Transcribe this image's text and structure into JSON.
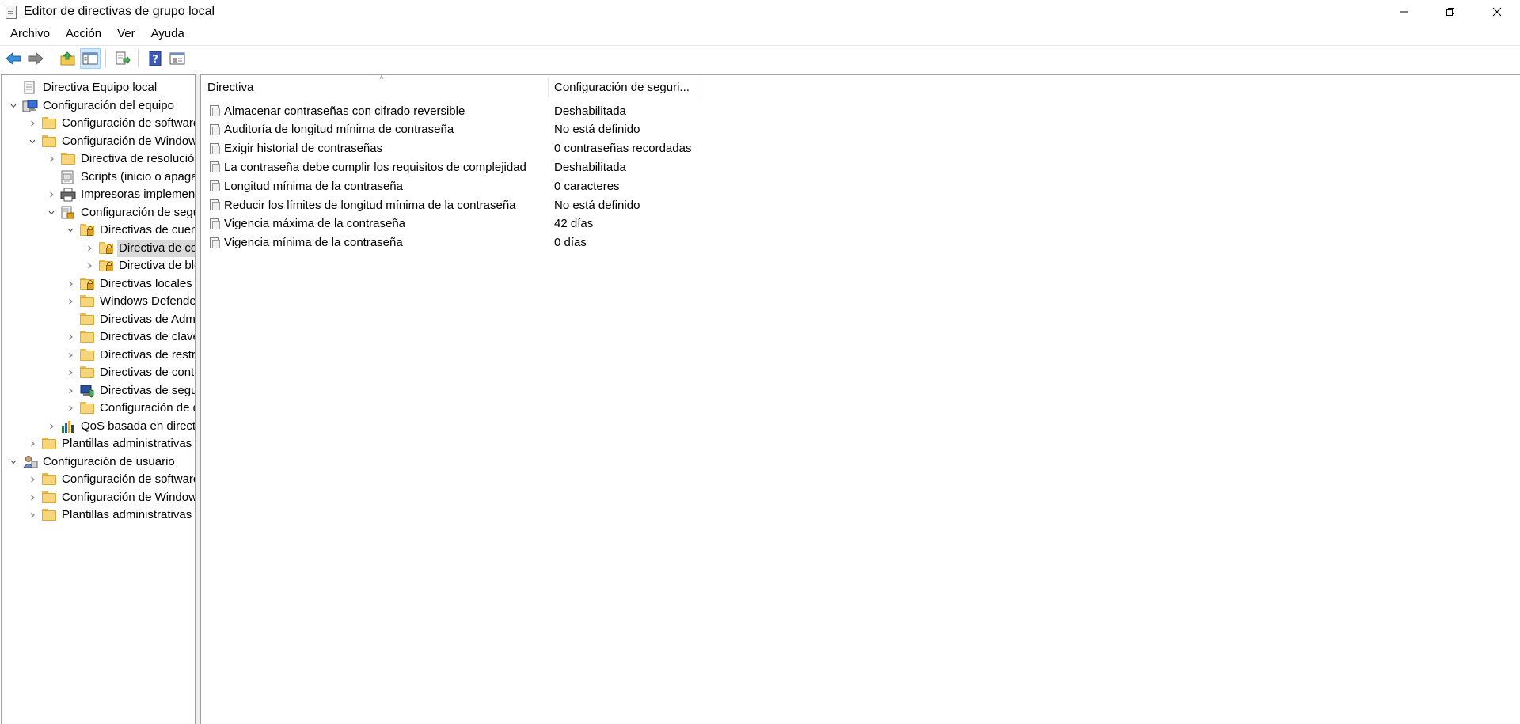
{
  "window": {
    "title": "Editor de directivas de grupo local"
  },
  "menu": [
    "Archivo",
    "Acción",
    "Ver",
    "Ayuda"
  ],
  "toolbar": {
    "icons": [
      "back-arrow-icon",
      "forward-arrow-icon",
      "up-folder-icon",
      "show-hide-tree-icon",
      "export-list-icon",
      "help-icon",
      "properties-icon"
    ]
  },
  "tree": [
    {
      "label": "Directiva Equipo local",
      "depth": 0,
      "icon": "policy-doc-icon",
      "expander": ""
    },
    {
      "label": "Configuración del equipo",
      "depth": 0,
      "icon": "computer-icon",
      "expander": "expanded"
    },
    {
      "label": "Configuración de software",
      "depth": 1,
      "icon": "folder-icon",
      "expander": "collapsed"
    },
    {
      "label": "Configuración de Windows",
      "depth": 1,
      "icon": "folder-icon",
      "expander": "expanded"
    },
    {
      "label": "Directiva de resolución de nombres",
      "depth": 2,
      "icon": "folder-icon",
      "expander": "collapsed"
    },
    {
      "label": "Scripts (inicio o apagado)",
      "depth": 2,
      "icon": "scripts-icon",
      "expander": ""
    },
    {
      "label": "Impresoras implementadas",
      "depth": 2,
      "icon": "printer-icon",
      "expander": "collapsed"
    },
    {
      "label": "Configuración de seguridad",
      "depth": 2,
      "icon": "security-settings-icon",
      "expander": "expanded"
    },
    {
      "label": "Directivas de cuenta",
      "depth": 3,
      "icon": "locked-folder-icon",
      "expander": "expanded"
    },
    {
      "label": "Directiva de contraseñas",
      "depth": 4,
      "icon": "locked-folder-icon",
      "expander": "collapsed",
      "selected": true
    },
    {
      "label": "Directiva de bloqueo de cuenta",
      "depth": 4,
      "icon": "locked-folder-icon",
      "expander": "collapsed"
    },
    {
      "label": "Directivas locales",
      "depth": 3,
      "icon": "locked-folder-icon",
      "expander": "collapsed"
    },
    {
      "label": "Windows Defender Firewall",
      "depth": 3,
      "icon": "folder-icon",
      "expander": "collapsed"
    },
    {
      "label": "Directivas de Administrador de listas de redes",
      "depth": 3,
      "icon": "folder-icon",
      "expander": ""
    },
    {
      "label": "Directivas de clave pública",
      "depth": 3,
      "icon": "folder-icon",
      "expander": "collapsed"
    },
    {
      "label": "Directivas de restricción de software",
      "depth": 3,
      "icon": "folder-icon",
      "expander": "collapsed"
    },
    {
      "label": "Directivas de control de aplicaciones",
      "depth": 3,
      "icon": "folder-icon",
      "expander": "collapsed"
    },
    {
      "label": "Directivas de seguridad IP",
      "depth": 3,
      "icon": "ip-security-icon",
      "expander": "collapsed"
    },
    {
      "label": "Configuración de directiva de auditoría avanzada",
      "depth": 3,
      "icon": "folder-icon",
      "expander": "collapsed"
    },
    {
      "label": "QoS basada en directivas",
      "depth": 2,
      "icon": "qos-chart-icon",
      "expander": "collapsed"
    },
    {
      "label": "Plantillas administrativas",
      "depth": 1,
      "icon": "folder-icon",
      "expander": "collapsed"
    },
    {
      "label": "Configuración de usuario",
      "depth": 0,
      "icon": "user-icon",
      "expander": "expanded"
    },
    {
      "label": "Configuración de software",
      "depth": 1,
      "icon": "folder-icon",
      "expander": "collapsed"
    },
    {
      "label": "Configuración de Windows",
      "depth": 1,
      "icon": "folder-icon",
      "expander": "collapsed"
    },
    {
      "label": "Plantillas administrativas",
      "depth": 1,
      "icon": "folder-icon",
      "expander": "collapsed"
    }
  ],
  "list": {
    "columns": [
      "Directiva",
      "Configuración de seguri..."
    ],
    "rows": [
      {
        "name": "Almacenar contraseñas con cifrado reversible",
        "value": "Deshabilitada"
      },
      {
        "name": "Auditoría de longitud mínima de contraseña",
        "value": "No está definido"
      },
      {
        "name": "Exigir historial de contraseñas",
        "value": "0 contraseñas recordadas"
      },
      {
        "name": "La contraseña debe cumplir los requisitos de complejidad",
        "value": "Deshabilitada"
      },
      {
        "name": "Longitud mínima de la contraseña",
        "value": "0 caracteres"
      },
      {
        "name": "Reducir los límites de longitud mínima de la contraseña",
        "value": "No está definido"
      },
      {
        "name": "Vigencia máxima de la contraseña",
        "value": "42 días"
      },
      {
        "name": "Vigencia mínima de la contraseña",
        "value": "0 días"
      }
    ]
  }
}
